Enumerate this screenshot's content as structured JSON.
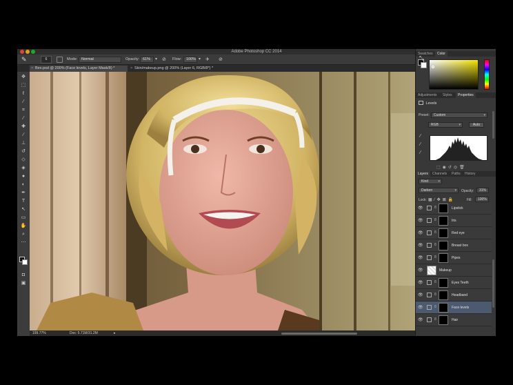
{
  "app": {
    "title": "Adobe Photoshop CC 2014",
    "colors": {
      "panel_bg": "#383838",
      "canvas_bg": "#282828",
      "selected_layer": "#4b5a6e"
    }
  },
  "options_bar": {
    "brush_size": "6",
    "mode_label": "Mode:",
    "mode_value": "Normal",
    "opacity_label": "Opacity:",
    "opacity_value": "61%",
    "flow_label": "Flow:",
    "flow_value": "100%"
  },
  "tabs": [
    {
      "label": "Bex.psd @ 200% (Face levels, Layer Mask/8) *",
      "active": true
    },
    {
      "label": "Skin/makeup.png @ 200% (Layer 6, RGB/8*) *",
      "active": false
    }
  ],
  "status_bar": {
    "zoom": "199.77%",
    "doc": "Doc: 5.71M/31.2M"
  },
  "color_panel": {
    "tabs": [
      "Swatches",
      "Color"
    ],
    "active_tab": "Color"
  },
  "properties_panel": {
    "tabs": [
      "Adjustments",
      "Styles",
      "Properties"
    ],
    "active_tab": "Properties",
    "title": "Levels",
    "preset_label": "Preset:",
    "preset_value": "Custom",
    "channel_value": "RGB",
    "auto_label": "Auto"
  },
  "layers_panel": {
    "tabs": [
      "Layers",
      "Channels",
      "Paths",
      "History"
    ],
    "active_tab": "Layers",
    "filter_value": "Kind",
    "blend_mode": "Darken",
    "opacity_label": "Opacity:",
    "opacity_value": "31%",
    "lock_label": "Lock:",
    "fill_label": "Fill:",
    "fill_value": "100%",
    "layers": [
      {
        "name": "Lipstick",
        "kind": "adjustment",
        "mask": "black",
        "selected": false
      },
      {
        "name": "Iris",
        "kind": "adjustment",
        "mask": "black",
        "selected": false
      },
      {
        "name": "Red eye",
        "kind": "adjustment",
        "mask": "black",
        "selected": false
      },
      {
        "name": "Breast box",
        "kind": "adjustment",
        "mask": "black",
        "selected": false
      },
      {
        "name": "Pipes",
        "kind": "adjustment",
        "mask": "black",
        "selected": false
      },
      {
        "name": "Makeup",
        "kind": "pixel",
        "mask": "none",
        "selected": false
      },
      {
        "name": "Eyes Teeth",
        "kind": "adjustment",
        "mask": "black",
        "selected": false
      },
      {
        "name": "Headband",
        "kind": "adjustment",
        "mask": "black",
        "selected": false
      },
      {
        "name": "Face levels",
        "kind": "adjustment",
        "mask": "black",
        "selected": true
      },
      {
        "name": "Hair",
        "kind": "adjustment",
        "mask": "black",
        "selected": false
      }
    ]
  }
}
